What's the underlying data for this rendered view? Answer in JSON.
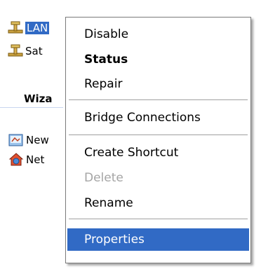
{
  "connections": [
    {
      "label": "LAN",
      "icon": "network-connection-icon"
    },
    {
      "label": "Sat",
      "icon": "network-connection-icon"
    }
  ],
  "tasks": {
    "heading": "Wiza",
    "items": [
      {
        "label": "New",
        "icon": "new-connection-icon"
      },
      {
        "label": "Net",
        "icon": "network-setup-icon"
      }
    ]
  },
  "context_menu": {
    "items": [
      {
        "label": "Disable"
      },
      {
        "label": "Status"
      },
      {
        "label": "Repair"
      },
      {
        "label": "Bridge Connections"
      },
      {
        "label": "Create Shortcut"
      },
      {
        "label": "Delete"
      },
      {
        "label": "Rename"
      },
      {
        "label": "Properties"
      }
    ]
  },
  "colors": {
    "selection": "#316ac5",
    "disabled_text": "#a5a5a5",
    "menu_border": "#7a7a7a"
  }
}
